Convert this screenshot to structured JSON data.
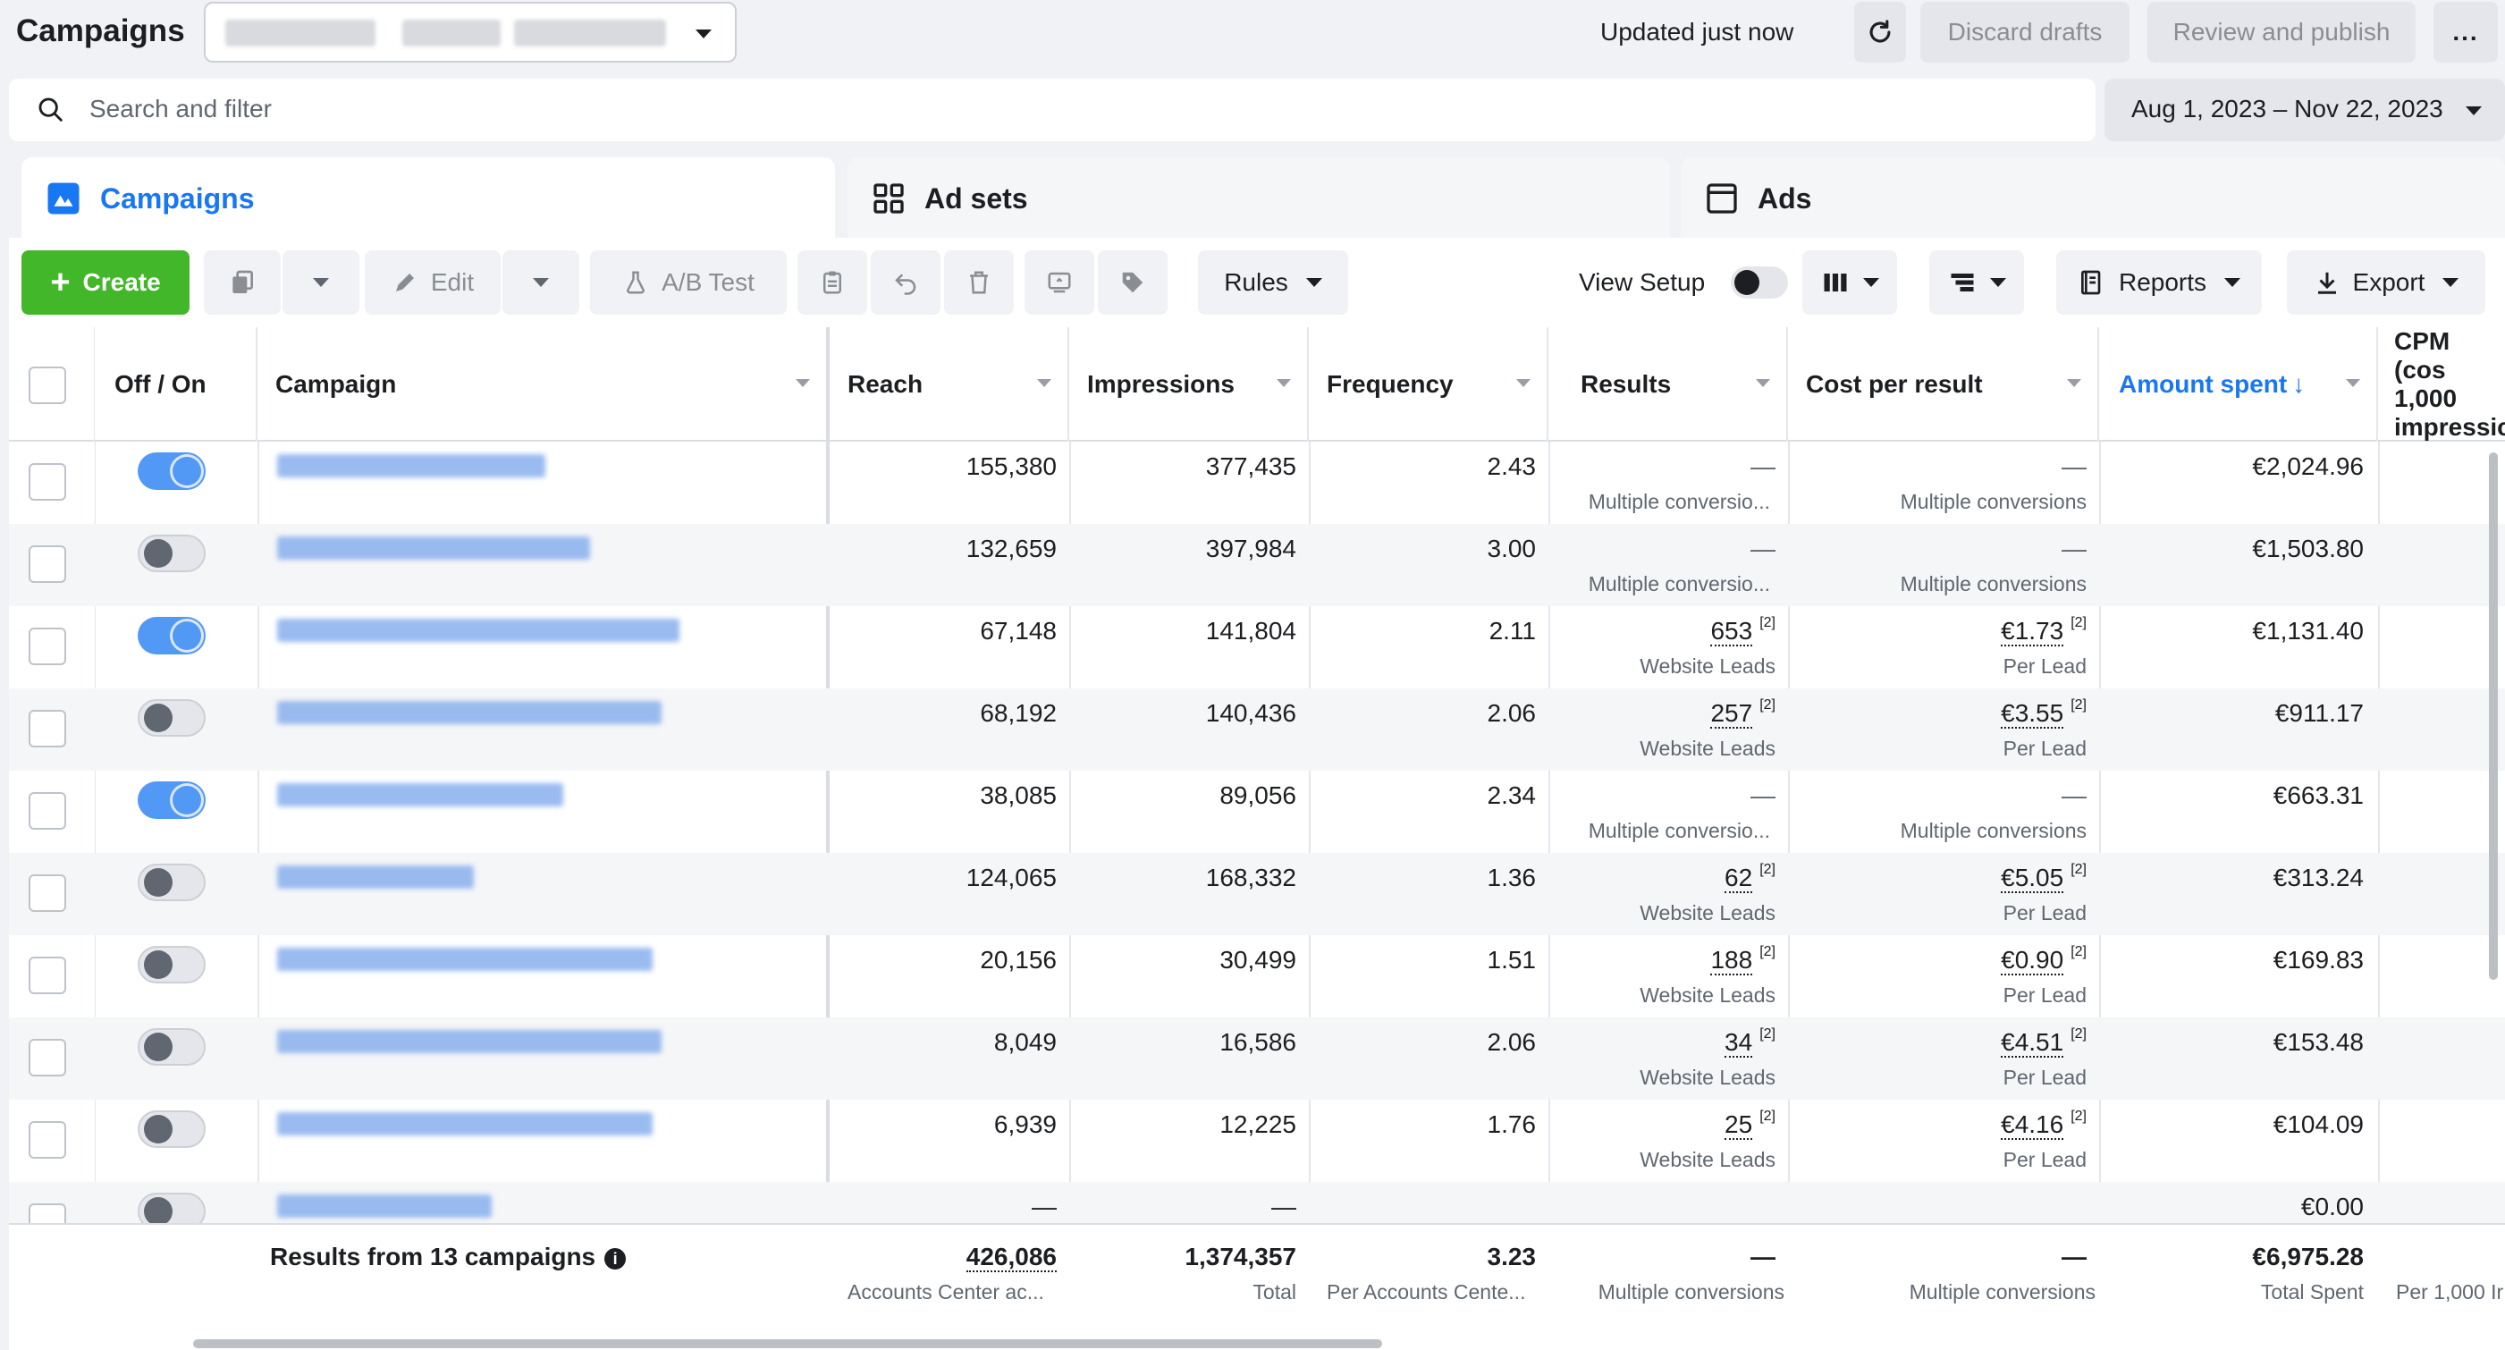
{
  "header": {
    "title": "Campaigns",
    "updated": "Updated just now",
    "discard_label": "Discard drafts",
    "review_label": "Review and publish",
    "more_label": "..."
  },
  "search": {
    "placeholder": "Search and filter"
  },
  "date_range": "Aug 1, 2023 – Nov 22, 2023",
  "tabs": [
    {
      "label": "Campaigns",
      "icon": "campaigns-icon"
    },
    {
      "label": "Ad sets",
      "icon": "grid-icon"
    },
    {
      "label": "Ads",
      "icon": "ad-window-icon"
    }
  ],
  "toolbar": {
    "create_label": "Create",
    "edit_label": "Edit",
    "abtest_label": "A/B Test",
    "rules_label": "Rules",
    "view_setup_label": "View Setup",
    "reports_label": "Reports",
    "export_label": "Export"
  },
  "columns": {
    "offon": "Off / On",
    "campaign": "Campaign",
    "reach": "Reach",
    "impressions": "Impressions",
    "frequency": "Frequency",
    "results": "Results",
    "cost_per_result": "Cost per result",
    "amount_spent": "Amount spent",
    "cpm_line1": "CPM (cos",
    "cpm_line2": "1,000",
    "cpm_line3": "impressic"
  },
  "rows": [
    {
      "on": true,
      "reach": "155,380",
      "impressions": "377,435",
      "frequency": "2.43",
      "results": "—",
      "results_sub": "Multiple conversio...",
      "cpr": "—",
      "cpr_sub": "Multiple conversions",
      "spent": "€2,024.96"
    },
    {
      "on": false,
      "reach": "132,659",
      "impressions": "397,984",
      "frequency": "3.00",
      "results": "—",
      "results_sub": "Multiple conversio...",
      "cpr": "—",
      "cpr_sub": "Multiple conversions",
      "spent": "€1,503.80"
    },
    {
      "on": true,
      "reach": "67,148",
      "impressions": "141,804",
      "frequency": "2.11",
      "results": "653",
      "results_sub": "Website Leads",
      "cpr": "€1.73",
      "cpr_sub": "Per Lead",
      "spent": "€1,131.40"
    },
    {
      "on": false,
      "reach": "68,192",
      "impressions": "140,436",
      "frequency": "2.06",
      "results": "257",
      "results_sub": "Website Leads",
      "cpr": "€3.55",
      "cpr_sub": "Per Lead",
      "spent": "€911.17"
    },
    {
      "on": true,
      "reach": "38,085",
      "impressions": "89,056",
      "frequency": "2.34",
      "results": "—",
      "results_sub": "Multiple conversio...",
      "cpr": "—",
      "cpr_sub": "Multiple conversions",
      "spent": "€663.31"
    },
    {
      "on": false,
      "reach": "124,065",
      "impressions": "168,332",
      "frequency": "1.36",
      "results": "62",
      "results_sub": "Website Leads",
      "cpr": "€5.05",
      "cpr_sub": "Per Lead",
      "spent": "€313.24"
    },
    {
      "on": false,
      "reach": "20,156",
      "impressions": "30,499",
      "frequency": "1.51",
      "results": "188",
      "results_sub": "Website Leads",
      "cpr": "€0.90",
      "cpr_sub": "Per Lead",
      "spent": "€169.83"
    },
    {
      "on": false,
      "reach": "8,049",
      "impressions": "16,586",
      "frequency": "2.06",
      "results": "34",
      "results_sub": "Website Leads",
      "cpr": "€4.51",
      "cpr_sub": "Per Lead",
      "spent": "€153.48"
    },
    {
      "on": false,
      "reach": "6,939",
      "impressions": "12,225",
      "frequency": "1.76",
      "results": "25",
      "results_sub": "Website Leads",
      "cpr": "€4.16",
      "cpr_sub": "Per Lead",
      "spent": "€104.09"
    },
    {
      "on": false,
      "reach": "—",
      "impressions": "—",
      "frequency": "",
      "results": "",
      "results_sub": "",
      "cpr": "",
      "cpr_sub": "",
      "spent": "€0.00"
    }
  ],
  "footer": {
    "label": "Results from 13 campaigns",
    "reach": "426,086",
    "reach_sub": "Accounts Center ac...",
    "impressions": "1,374,357",
    "impressions_sub": "Total",
    "frequency": "3.23",
    "frequency_sub": "Per Accounts Cente...",
    "results": "—",
    "results_sub": "Multiple conversions",
    "cpr": "—",
    "cpr_sub": "Multiple conversions",
    "spent": "€6,975.28",
    "spent_sub": "Total Spent",
    "cpm_sub": "Per 1,000 Ir"
  },
  "footnote_marker": "[2]",
  "sort_arrow": "↓",
  "colors": {
    "accent": "#1877f2",
    "create": "#42b72a"
  }
}
